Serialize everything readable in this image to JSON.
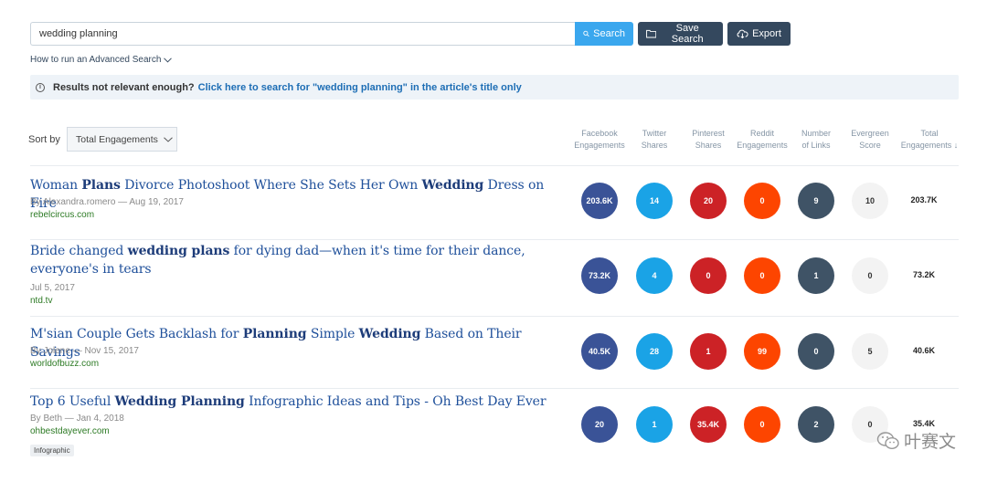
{
  "search": {
    "value": "wedding planning",
    "search_label": "Search",
    "save_label": "Save Search",
    "export_label": "Export",
    "advanced_link": "How to run an Advanced Search"
  },
  "notice": {
    "lead": "Results not relevant enough?",
    "link": "Click here to search for \"wedding planning\" in the article's title only"
  },
  "sort": {
    "label": "Sort by",
    "selected": "Total Engagements"
  },
  "columns": [
    {
      "line1": "Facebook",
      "line2": "Engagements"
    },
    {
      "line1": "Twitter",
      "line2": "Shares"
    },
    {
      "line1": "Pinterest",
      "line2": "Shares"
    },
    {
      "line1": "Reddit",
      "line2": "Engagements"
    },
    {
      "line1": "Number",
      "line2": "of Links"
    },
    {
      "line1": "Evergreen",
      "line2": "Score"
    },
    {
      "line1": "Total",
      "line2": "Engagements ↓"
    }
  ],
  "results": [
    {
      "title_parts": [
        [
          "Woman ",
          false
        ],
        [
          "Plans",
          true
        ],
        [
          " Divorce Photoshoot Where She Sets Her Own ",
          false
        ],
        [
          "Wedding",
          true
        ],
        [
          " Dress on Fire",
          false
        ]
      ],
      "meta": "By Alexandra.romero — Aug 19, 2017",
      "domain": "rebelcircus.com",
      "facebook": "203.6K",
      "twitter": "14",
      "pinterest": "20",
      "reddit": "0",
      "links": "9",
      "evergreen": "10",
      "total": "203.7K"
    },
    {
      "title_parts": [
        [
          "Bride changed ",
          false
        ],
        [
          "wedding plans",
          true
        ],
        [
          " for dying dad—when it's time for their dance, everyone's in tears",
          false
        ]
      ],
      "meta": "Jul 5, 2017",
      "domain": "ntd.tv",
      "facebook": "73.2K",
      "twitter": "4",
      "pinterest": "0",
      "reddit": "0",
      "links": "1",
      "evergreen": "0",
      "total": "73.2K"
    },
    {
      "title_parts": [
        [
          "M'sian Couple Gets Backlash for ",
          false
        ],
        [
          "Planning",
          true
        ],
        [
          " Simple ",
          false
        ],
        [
          "Wedding",
          true
        ],
        [
          " Based on Their Savings",
          false
        ]
      ],
      "meta": "By Jolene — Nov 15, 2017",
      "domain": "worldofbuzz.com",
      "facebook": "40.5K",
      "twitter": "28",
      "pinterest": "1",
      "reddit": "99",
      "links": "0",
      "evergreen": "5",
      "total": "40.6K"
    },
    {
      "title_parts": [
        [
          "Top 6 Useful ",
          false
        ],
        [
          "Wedding Planning",
          true
        ],
        [
          " Infographic Ideas and Tips - Oh Best Day Ever",
          false
        ]
      ],
      "meta": "By Beth — Jan 4, 2018",
      "domain": "ohbestdayever.com",
      "tag": "Infographic",
      "facebook": "20",
      "twitter": "1",
      "pinterest": "35.4K",
      "reddit": "0",
      "links": "2",
      "evergreen": "0",
      "total": "35.4K"
    }
  ],
  "watermark": "叶赛文",
  "colors": {
    "facebook": "#3a5397",
    "twitter": "#1aa3e6",
    "pinterest": "#cc2226",
    "reddit": "#fd4500",
    "links": "#3f5366",
    "evergreen": "#f3f3f3",
    "search_button": "#3aa7ee",
    "dark_button": "#34485e",
    "title_link": "#1e4f9a",
    "domain": "#2c7a24"
  }
}
